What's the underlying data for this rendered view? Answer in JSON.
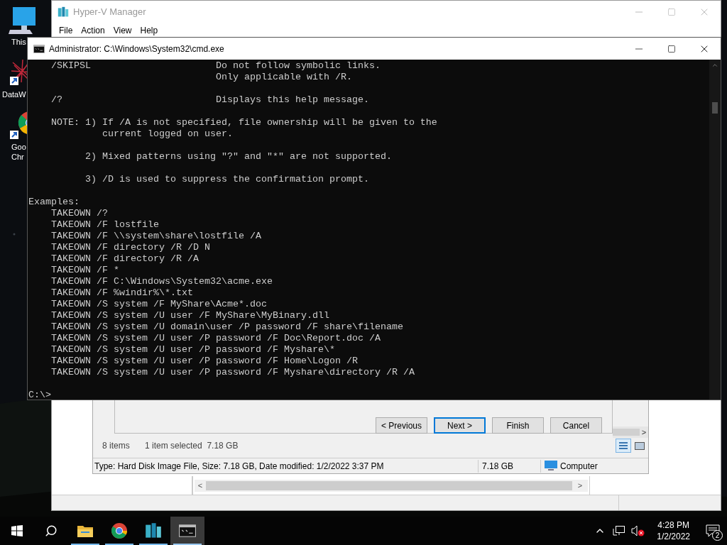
{
  "desktop_icons": [
    {
      "kind": "pc",
      "lines": [
        "This"
      ]
    },
    {
      "kind": "dataw",
      "lines": [
        "DataW"
      ]
    },
    {
      "kind": "chrome",
      "lines": [
        "Goo",
        "Chr"
      ]
    }
  ],
  "hyperv": {
    "title": "Hyper-V Manager",
    "menu": [
      "File",
      "Action",
      "View",
      "Help"
    ]
  },
  "dialog": {
    "buttons": [
      {
        "label": "< Previous",
        "default": false
      },
      {
        "label": "Next >",
        "default": true
      },
      {
        "label": "Finish",
        "default": false
      },
      {
        "label": "Cancel",
        "default": false
      }
    ],
    "items_count": "8 items",
    "selection": "1 item selected  7.18 GB",
    "scroll_right": ">",
    "status": {
      "details": "Type: Hard Disk Image File, Size: 7.18 GB, Date modified: 1/2/2022 3:37 PM",
      "size": "7.18 GB",
      "location": "Computer"
    },
    "pane_scroll_left": "<",
    "pane_scroll_right": ">"
  },
  "cmd": {
    "title": "Administrator: C:\\Windows\\System32\\cmd.exe",
    "blocks": [
      [
        "    /SKIPSL                      Do not follow symbolic links.",
        "                                 Only applicable with /R."
      ],
      [
        "    /?                           Displays this help message."
      ],
      [
        "    NOTE: 1) If /A is not specified, file ownership will be given to the",
        "             current logged on user."
      ],
      [
        "          2) Mixed patterns using \"?\" and \"*\" are not supported."
      ],
      [
        "          3) /D is used to suppress the confirmation prompt."
      ],
      [
        "Examples:",
        "    TAKEOWN /?",
        "    TAKEOWN /F lostfile",
        "    TAKEOWN /F \\\\system\\share\\lostfile /A",
        "    TAKEOWN /F directory /R /D N",
        "    TAKEOWN /F directory /R /A",
        "    TAKEOWN /F *",
        "    TAKEOWN /F C:\\Windows\\System32\\acme.exe",
        "    TAKEOWN /F %windir%\\*.txt",
        "    TAKEOWN /S system /F MyShare\\Acme*.doc",
        "    TAKEOWN /S system /U user /F MyShare\\MyBinary.dll",
        "    TAKEOWN /S system /U domain\\user /P password /F share\\filename",
        "    TAKEOWN /S system /U user /P password /F Doc\\Report.doc /A",
        "    TAKEOWN /S system /U user /P password /F Myshare\\*",
        "    TAKEOWN /S system /U user /P password /F Home\\Logon /R",
        "    TAKEOWN /S system /U user /P password /F Myshare\\directory /R /A"
      ],
      [
        "C:\\>"
      ]
    ]
  },
  "taskbar": {
    "apps": [
      {
        "kind": "explorer",
        "running": true,
        "active": false
      },
      {
        "kind": "chrome",
        "running": true,
        "active": false
      },
      {
        "kind": "hyperv",
        "running": true,
        "active": false
      },
      {
        "kind": "cmd",
        "running": true,
        "active": true
      }
    ],
    "time": "4:28 PM",
    "date": "1/2/2022",
    "notifications": "2"
  }
}
